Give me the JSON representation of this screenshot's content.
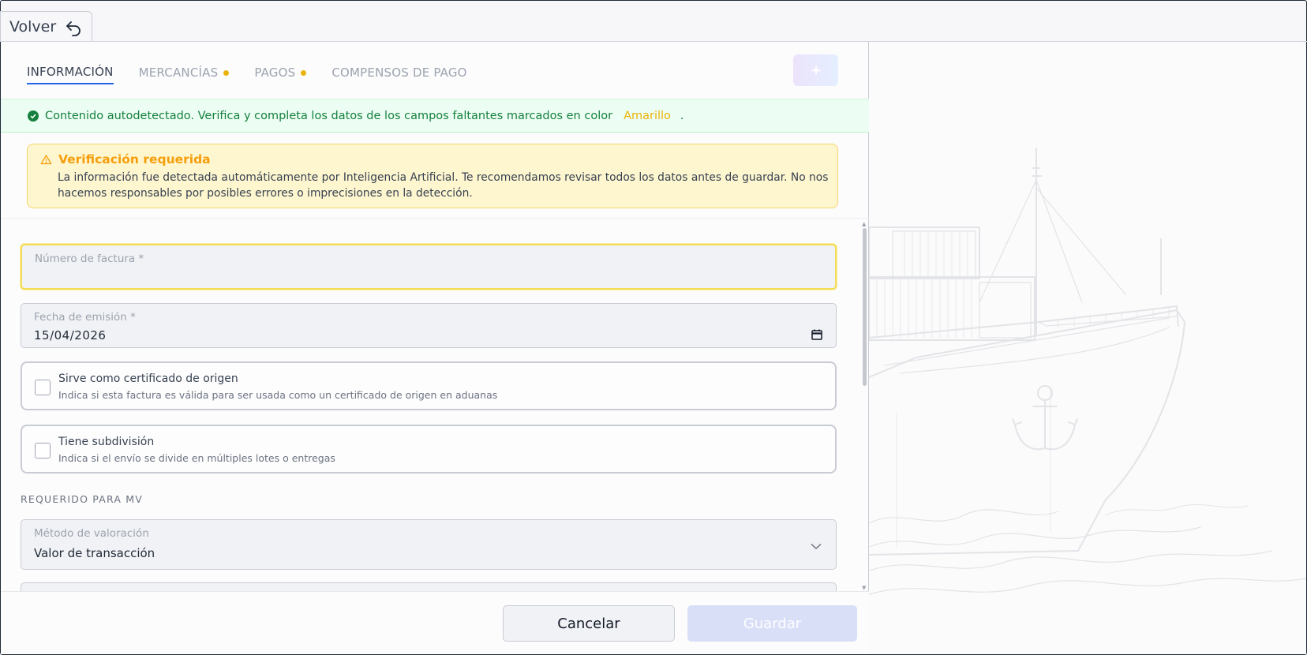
{
  "back": {
    "label": "Volver"
  },
  "tabs": [
    {
      "label": "INFORMACIÓN",
      "active": true,
      "dot": false
    },
    {
      "label": "MERCANCÍAS",
      "active": false,
      "dot": true
    },
    {
      "label": "PAGOS",
      "active": false,
      "dot": true
    },
    {
      "label": "COMPENSOS DE PAGO",
      "active": false,
      "dot": false
    }
  ],
  "success": {
    "text": "Contenido autodetectado. Verifica y completa los datos de los campos faltantes marcados en color",
    "highlight": "Amarillo",
    "end": "."
  },
  "warning": {
    "title": "Verificación requerida",
    "text": "La información fue detectada automáticamente por Inteligencia Artificial. Te recomendamos revisar todos los datos antes de guardar. No nos hacemos responsables por posibles errores o imprecisiones en la detección."
  },
  "form": {
    "invoice_number": {
      "label": "Número de factura *",
      "value": ""
    },
    "issue_date": {
      "label": "Fecha de emisión *",
      "value": "15/04/2026"
    },
    "certificate": {
      "title": "Sirve como certificado de origen",
      "sub": "Indica si esta factura es válida para ser usada como un certificado de origen en aduanas",
      "checked": false
    },
    "subdivision": {
      "title": "Tiene subdivisión",
      "sub": "Indica si el envío se divide en múltiples lotes o entregas",
      "checked": false
    },
    "section_mv": "REQUERIDO PARA MV",
    "valuation": {
      "label": "Método de valoración",
      "value": "Valor de transacción"
    }
  },
  "footer": {
    "cancel": "Cancelar",
    "save": "Guardar"
  },
  "colors": {
    "accent": "#2563eb",
    "warning": "#f59e0b",
    "success": "#15803d",
    "pending_dot": "#eab308"
  },
  "icons": [
    "undo-arrow-icon",
    "sparkles-icon",
    "check-circle-icon",
    "warning-triangle-icon",
    "calendar-icon",
    "chevron-down-icon",
    "ship-illustration"
  ]
}
